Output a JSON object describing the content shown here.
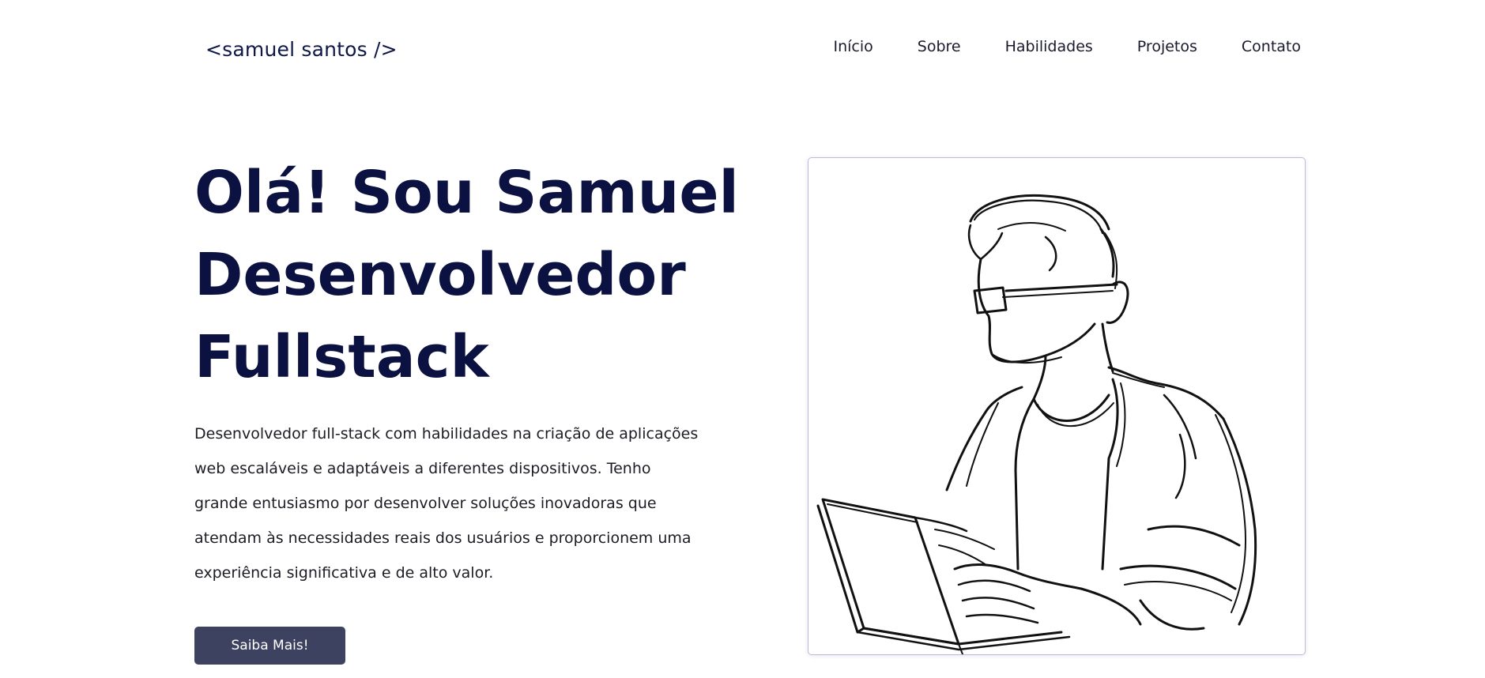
{
  "header": {
    "logo": "<samuel santos />",
    "nav": [
      {
        "label": "Início"
      },
      {
        "label": "Sobre"
      },
      {
        "label": "Habilidades"
      },
      {
        "label": "Projetos"
      },
      {
        "label": "Contato"
      }
    ]
  },
  "hero": {
    "title_lines": [
      "Olá! Sou Samuel",
      "Desenvolvedor",
      "Fullstack"
    ],
    "description": "Desenvolvedor full-stack com habilidades na criação de aplicações web escaláveis e adaptáveis a diferentes dispositivos. Tenho grande entusiasmo por desenvolver soluções inovadoras que atendam às necessidades reais dos usuários e proporcionem uma experiência significativa e de alto valor.",
    "cta_label": "Saiba Mais!"
  },
  "colors": {
    "title": "#0b1140",
    "button": "#3d4260",
    "card_border": "#b8bde0"
  }
}
